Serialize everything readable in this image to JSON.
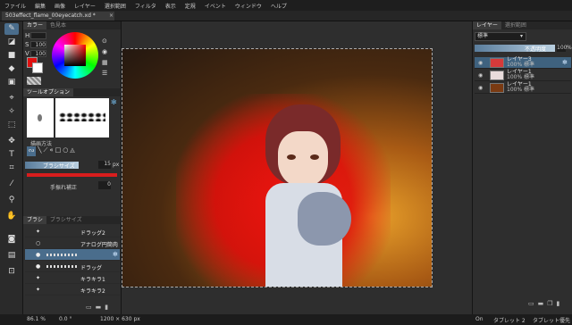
{
  "menu": [
    "ファイル",
    "編集",
    "画像",
    "レイヤー",
    "選択範囲",
    "フィルタ",
    "表示",
    "定規",
    "イベント",
    "ウィンドウ",
    "ヘルプ"
  ],
  "document": {
    "tab_label": "503effect_flame_00eyecatch.xd *",
    "close_glyph": "×"
  },
  "tools": [
    "pointer-icon",
    "eraser-icon",
    "rect-icon",
    "fill-icon",
    "gradient-icon",
    "lasso-icon",
    "move-icon",
    "text-icon",
    "crop-icon",
    "eyedropper-icon",
    "hand-icon"
  ],
  "color_panel": {
    "tabs": [
      "カラー",
      "色見本"
    ],
    "channels": [
      {
        "label": "H",
        "value": ""
      },
      {
        "label": "S",
        "value": "100"
      },
      {
        "label": "V",
        "value": "100"
      }
    ],
    "primary": "#e01010",
    "secondary": "#ffffff"
  },
  "tool_options": {
    "title": "ツールオプション",
    "section_title": "描画方法",
    "brush_size_label": "ブラシサイズ",
    "brush_size_value": "15",
    "brush_size_unit": "px",
    "stabilizer_label": "手振れ補正",
    "stabilizer_value": "0"
  },
  "brush_panel": {
    "tabs": [
      "ブラシ",
      "ブラシサイズ"
    ],
    "items": [
      {
        "name": "ドラッグ2",
        "selected": false
      },
      {
        "name": "アナログ円筒肉",
        "selected": false
      },
      {
        "name": "",
        "selected": true
      },
      {
        "name": "ドラッグ",
        "selected": false
      },
      {
        "name": "キラキラ1",
        "selected": false
      },
      {
        "name": "キラキラ2",
        "selected": false
      }
    ]
  },
  "layers_panel": {
    "tabs": [
      "レイヤー",
      "選択範囲"
    ],
    "blend_mode": "標準",
    "opacity_label": "不透明度",
    "opacity_value": "100",
    "opacity_unit": "%",
    "layers": [
      {
        "name": "レイヤー3",
        "info": "100% 標準",
        "selected": true,
        "thumb": "#d63a3a"
      },
      {
        "name": "レイヤー1",
        "info": "100% 標準",
        "selected": false,
        "thumb": "#e8dcdc"
      },
      {
        "name": "レイヤー1",
        "info": "100% 標準",
        "selected": false,
        "thumb": "#7a3a12"
      }
    ]
  },
  "status": {
    "zoom": "86.1 %",
    "angle": "0.0 °",
    "size": "1200 × 630 px",
    "pen": "On",
    "tablet1": "タブレット 2",
    "tablet2": "タブレット優先"
  }
}
